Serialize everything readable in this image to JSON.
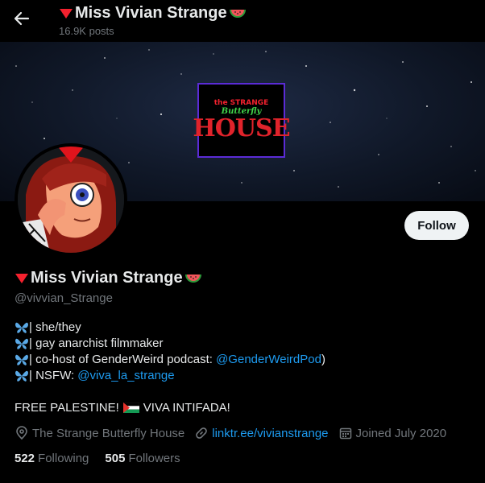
{
  "header": {
    "title": "Miss Vivian Strange",
    "posts_count": "16.9K posts"
  },
  "banner": {
    "logo_line1": "the STRANGE",
    "logo_line2": "Butterfly",
    "logo_line3": "HOUSE"
  },
  "profile": {
    "display_name": "Miss Vivian Strange",
    "handle": "@vivvian_Strange",
    "follow_label": "Follow",
    "bio": {
      "line1": "| she/they",
      "line2": "| gay anarchist filmmaker",
      "line3_prefix": "| co-host of GenderWeird podcast: ",
      "line3_link": "@GenderWeirdPod",
      "line3_suffix": ")",
      "line4_prefix": "| NSFW: ",
      "line4_link": "@viva_la_strange"
    },
    "free_prefix": "FREE PALESTINE!",
    "free_suffix": "VIVA INTIFADA!",
    "location": "The Strange Butterfly House",
    "website": "linktr.ee/vivianstrange",
    "joined": "Joined July 2020",
    "following_count": "522",
    "following_label": "Following",
    "followers_count": "505",
    "followers_label": "Followers"
  },
  "icons": {
    "back": "back-arrow-icon",
    "red_triangle": "red-triangle-icon",
    "watermelon": "watermelon-icon",
    "butterfly": "butterfly-icon",
    "flag": "palestine-flag-icon",
    "location": "location-pin-icon",
    "link": "link-icon",
    "calendar": "calendar-icon"
  },
  "colors": {
    "background": "#000000",
    "text": "#e7e9ea",
    "muted": "#71767b",
    "link": "#1d9bf0",
    "follow_bg": "#eff3f4"
  }
}
